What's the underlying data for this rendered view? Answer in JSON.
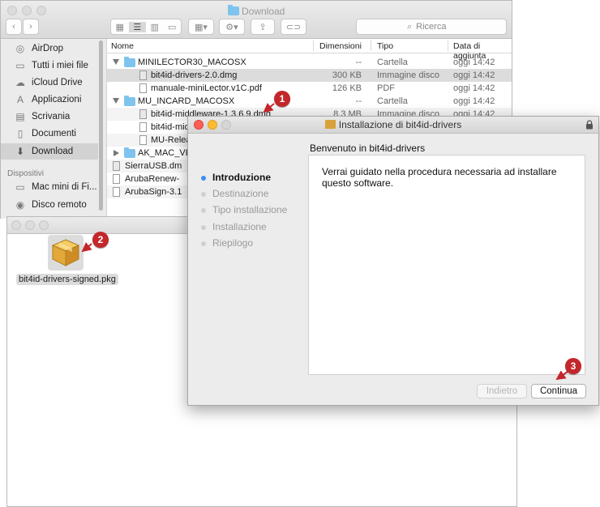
{
  "finder": {
    "title": "Download",
    "search_placeholder": "Ricerca",
    "sidebar_items": [
      {
        "label": "AirDrop"
      },
      {
        "label": "Tutti i miei file"
      },
      {
        "label": "iCloud Drive"
      },
      {
        "label": "Applicazioni"
      },
      {
        "label": "Scrivania"
      },
      {
        "label": "Documenti"
      },
      {
        "label": "Download"
      }
    ],
    "devices_header": "Dispositivi",
    "device_items": [
      {
        "label": "Mac mini di Fi..."
      },
      {
        "label": "Disco remoto"
      }
    ],
    "columns": {
      "name": "Nome",
      "size": "Dimensioni",
      "kind": "Tipo",
      "date": "Data di aggiunta"
    },
    "rows": [
      {
        "name": "MINILECTOR30_MACOSX",
        "size": "--",
        "kind": "Cartella",
        "date": "oggi 14:42"
      },
      {
        "name": "bit4id-drivers-2.0.dmg",
        "size": "300 KB",
        "kind": "Immagine disco",
        "date": "oggi 14:42"
      },
      {
        "name": "manuale-miniLector.v1C.pdf",
        "size": "126 KB",
        "kind": "PDF",
        "date": "oggi 14:42"
      },
      {
        "name": "MU_INCARD_MACOSX",
        "size": "--",
        "kind": "Cartella",
        "date": "oggi 14:42"
      },
      {
        "name": "bit4id-middleware-1.3.6.9.dmg",
        "size": "8,3 MB",
        "kind": "Immagine disco",
        "date": "oggi 14:42"
      },
      {
        "name": "bit4id-mid"
      },
      {
        "name": "MU-Relea"
      },
      {
        "name": "AK_MAC_VER"
      },
      {
        "name": "SierraUSB.dm"
      },
      {
        "name": "ArubaRenew-"
      },
      {
        "name": "ArubaSign-3.1"
      }
    ]
  },
  "finder2": {
    "file_label": "bit4id-drivers-signed.pkg"
  },
  "installer": {
    "title": "Installazione di bit4id-drivers",
    "welcome": "Benvenuto in bit4id-drivers",
    "body": "Verrai guidato nella procedura necessaria ad installare questo software.",
    "steps": [
      "Introduzione",
      "Destinazione",
      "Tipo installazione",
      "Installazione",
      "Riepilogo"
    ],
    "back_label": "Indietro",
    "continue_label": "Continua"
  },
  "callouts": [
    "1",
    "2",
    "3"
  ],
  "colors": {
    "callout": "#c3272b",
    "active_step": "#3d8ef3"
  }
}
